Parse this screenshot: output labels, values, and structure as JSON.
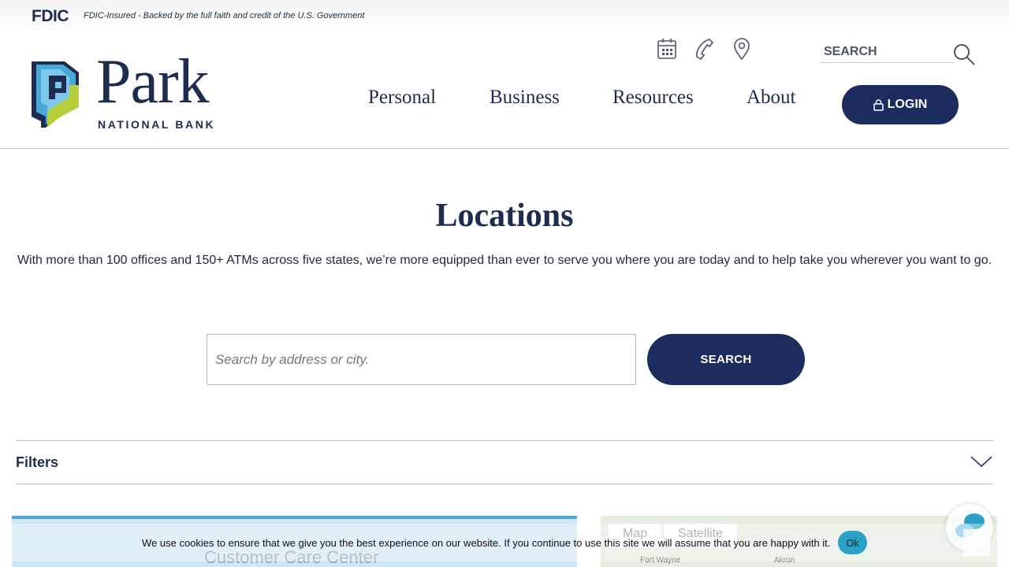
{
  "fdic": {
    "logo": "FDIC",
    "tagline": "FDIC-Insured - Backed by the full faith and credit of the U.S. Government"
  },
  "brand": {
    "name": "Park",
    "subtitle": "NATIONAL BANK",
    "colors": {
      "navy": "#1d2c4f",
      "blue": "#48a8d8",
      "lime": "#b5cf3a"
    }
  },
  "utility": {
    "icons": [
      "calendar-icon",
      "phone-icon",
      "location-pin-icon"
    ],
    "search_placeholder": "SEARCH"
  },
  "nav": {
    "items": [
      {
        "label": "Personal"
      },
      {
        "label": "Business"
      },
      {
        "label": "Resources"
      },
      {
        "label": "About"
      }
    ],
    "login_label": "LOGIN"
  },
  "main": {
    "title": "Locations",
    "intro": "With more than 100 offices and 150+ ATMs across five states, we’re more equipped than ever to serve you where you are today and to help take you wherever you want to go.",
    "search_placeholder": "Search by address or city.",
    "search_button": "SEARCH",
    "filters_label": "Filters"
  },
  "lower": {
    "care_title": "Customer Care Center",
    "map_tabs": [
      "Map",
      "Satellite"
    ],
    "map_cities": [
      "Fort Wayne",
      "Akron"
    ]
  },
  "cookie": {
    "text": "We use cookies to ensure that we give you the best experience on our website. If you continue to use this site we will assume that you are happy with it.",
    "ok_label": "Ok"
  },
  "colors": {
    "primary_button": "#1d2c5e",
    "cookie_ok": "#2aa0c4"
  }
}
